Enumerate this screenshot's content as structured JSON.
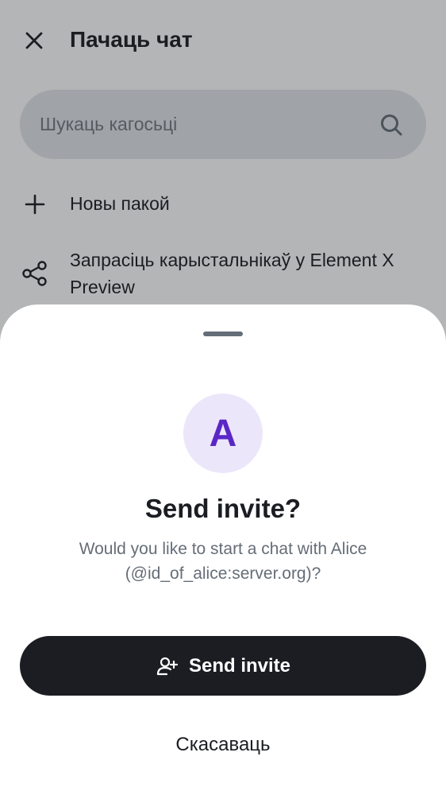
{
  "header": {
    "title": "Пачаць чат",
    "close_icon": "close-icon"
  },
  "search": {
    "placeholder": "Шукаць кагосьці",
    "value": "",
    "icon": "search-icon"
  },
  "actions": [
    {
      "label": "Новы пакой",
      "icon": "plus-icon"
    },
    {
      "label": "Запрасіць карыстальнікаў у Element X Preview",
      "icon": "share-icon"
    }
  ],
  "dialog": {
    "avatar_letter": "A",
    "title": "Send invite?",
    "message": "Would you like to start a chat with Alice (@id_of_alice:server.org)?",
    "primary_label": "Send invite",
    "primary_icon": "user-add-icon",
    "secondary_label": "Скасаваць"
  },
  "colors": {
    "text_primary": "#1b1d22",
    "text_secondary": "#656d77",
    "avatar_bg": "#ece6fb",
    "avatar_fg": "#5a27c6",
    "button_bg": "#1b1d22"
  }
}
